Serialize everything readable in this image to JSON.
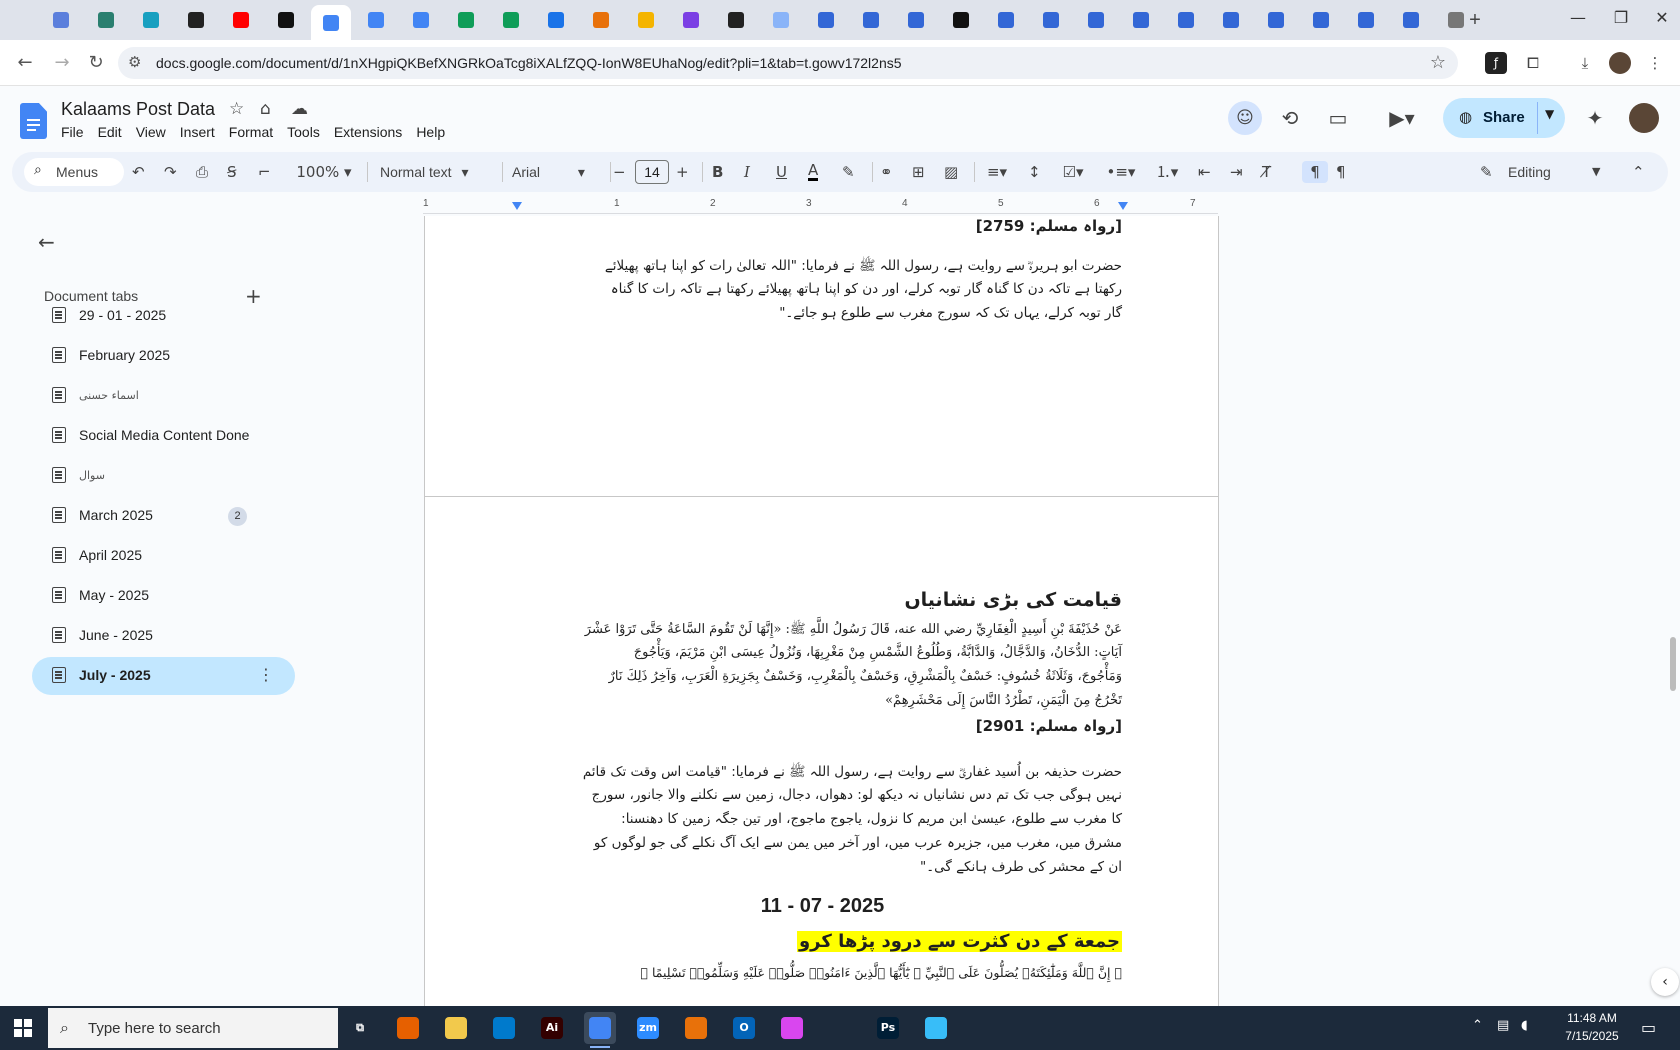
{
  "browser": {
    "tabs": [
      {
        "icon": "gemini-icon",
        "color": "#5b7fdc"
      },
      {
        "icon": "app-icon",
        "color": "#2a7f6f"
      },
      {
        "icon": "app-icon",
        "color": "#18a0c0"
      },
      {
        "icon": "chatgpt-icon",
        "color": "#222222"
      },
      {
        "icon": "youtube-icon",
        "color": "#ff0000"
      },
      {
        "icon": "app-icon",
        "color": "#111111"
      },
      {
        "icon": "docs-icon",
        "color": "#4285f4",
        "active": true
      },
      {
        "icon": "docs-icon",
        "color": "#4285f4"
      },
      {
        "icon": "docs-icon",
        "color": "#4285f4"
      },
      {
        "icon": "sheets-icon",
        "color": "#0f9d58"
      },
      {
        "icon": "sheets-icon",
        "color": "#0f9d58"
      },
      {
        "icon": "app-icon",
        "color": "#1a73e8"
      },
      {
        "icon": "app-icon",
        "color": "#e8710a"
      },
      {
        "icon": "app-icon",
        "color": "#f4b400"
      },
      {
        "icon": "app-icon",
        "color": "#7b3fe4"
      },
      {
        "icon": "app-icon",
        "color": "#222222"
      },
      {
        "icon": "app-icon",
        "color": "#8ab4f8"
      },
      {
        "icon": "forms-icon",
        "color": "#3367d6"
      },
      {
        "icon": "forms-icon",
        "color": "#3367d6"
      },
      {
        "icon": "forms-icon",
        "color": "#3367d6"
      },
      {
        "icon": "app-icon",
        "color": "#111111"
      },
      {
        "icon": "forms-icon",
        "color": "#3367d6"
      },
      {
        "icon": "forms-icon",
        "color": "#3367d6"
      },
      {
        "icon": "forms-icon",
        "color": "#3367d6"
      },
      {
        "icon": "forms-icon",
        "color": "#3367d6"
      },
      {
        "icon": "forms-icon",
        "color": "#3367d6"
      },
      {
        "icon": "forms-icon",
        "color": "#3367d6"
      },
      {
        "icon": "forms-icon",
        "color": "#3367d6"
      },
      {
        "icon": "forms-icon",
        "color": "#3367d6"
      },
      {
        "icon": "forms-icon",
        "color": "#3367d6"
      },
      {
        "icon": "forms-icon",
        "color": "#3367d6"
      },
      {
        "icon": "chrome-icon",
        "color": "#777777"
      }
    ],
    "new_tab": "+",
    "url": "docs.google.com/document/d/1nXHgpiQKBefXNGRkOaTcg8iXALfZQQ-IonW8EUhaNog/edit?pli=1&tab=t.gowv172l2ns5"
  },
  "doc": {
    "title": "Kalaams Post Data",
    "menu": [
      "File",
      "Edit",
      "View",
      "Insert",
      "Format",
      "Tools",
      "Extensions",
      "Help"
    ],
    "share_label": "Share"
  },
  "toolbar": {
    "menus_label": "Menus",
    "zoom": "100%",
    "style": "Normal text",
    "font": "Arial",
    "font_size": "14",
    "mode": "Editing"
  },
  "ruler": [
    "1",
    "1",
    "2",
    "3",
    "4",
    "5",
    "6",
    "7"
  ],
  "sidebar": {
    "heading": "Document tabs",
    "tabs": [
      {
        "label": "29 - 01 - 2025"
      },
      {
        "label": "February 2025"
      },
      {
        "label": "اسماء حسنی"
      },
      {
        "label": "Social Media Content Done"
      },
      {
        "label": "سوال"
      },
      {
        "label": "March 2025",
        "badge": "2"
      },
      {
        "label": "April 2025"
      },
      {
        "label": "May - 2025"
      },
      {
        "label": "June - 2025"
      },
      {
        "label": "July - 2025",
        "selected": true
      }
    ]
  },
  "content": {
    "page1": {
      "ref_top": "[رواہ مسلم: 2759]",
      "para": [
        "حضرت ابو ہریرہؓ سے روایت ہے، رسول اللہ ﷺ نے فرمایا: \"اللہ تعالیٰ رات کو اپنا ہاتھ پھیلائے",
        "رکھتا ہے تاکہ دن کا گناہ گار توبہ کرلے، اور دن کو اپنا ہاتھ پھیلائے رکھتا ہے تاکہ رات کا گناہ",
        "گار توبہ کرلے، یہاں تک کہ سورج مغرب سے طلوع ہو جائے۔\""
      ]
    },
    "page2": {
      "heading": "قیامت کی بڑی نشانیاں",
      "arabic": [
        "عَنْ حُذَيْفَةَ بْنِ أَسِيدٍ الْغِفَارِيِّ رضي الله عنه، قَالَ رَسُولُ اللَّهِ ﷺ: «إِنَّهَا لَنْ تَقُومَ السَّاعَةُ حَتَّى تَرَوْا عَشْرَ",
        "آيَاتٍ: الدُّخَانُ، وَالدَّجَّالُ، وَالدَّابَّةُ، وَطُلُوعُ الشَّمْسِ مِنْ مَغْرِبِهَا، وَنُزُولُ عِيسَى ابْنِ مَرْيَمَ، وَيَأْجُوجَ",
        "وَمَأْجُوجَ، وَثَلَاثَةُ خُسُوفٍ: خَسْفٌ بِالْمَشْرِقِ، وَخَسْفٌ بِالْمَغْرِبِ، وَخَسْفٌ بِجَزِيرَةِ الْعَرَبِ، وَآخِرُ ذَلِكَ نَارٌ",
        "تَخْرُجُ مِنَ الْيَمَنِ، تَطْرُدُ النَّاسَ إِلَى مَحْشَرِهِمْ»"
      ],
      "ref": "[رواہ مسلم: 2901]",
      "urdu": [
        "حضرت حذیفہ بن اُسید غفاریؓ سے روایت ہے، رسول اللہ ﷺ نے فرمایا: \"قیامت اس وقت تک قائم",
        "نہیں ہوگی جب تک تم دس نشانیاں نہ دیکھ لو: دھواں، دجال، زمین سے نکلنے والا جانور، سورج",
        "کا مغرب سے طلوع، عیسیٰ ابن مریم کا نزول، یاجوج ماجوج، اور تین جگہ زمین کا دھنسنا:",
        "مشرق میں، مغرب میں، جزیرہ عرب میں، اور آخر میں یمن سے ایک آگ نکلے گی جو لوگوں کو",
        "ان کے محشر کی طرف ہانکے گی۔\""
      ],
      "date": "11 - 07 - 2025",
      "highlight_heading": "جمعة کے دن کثرت سے درود پڑھا کرو",
      "verse": "﴿ إِنَّ ٱللَّهَ وَمَلَٰٓئِكَتَهُۥ يُصَلُّونَ عَلَى ٱلنَّبِيِّ ۚ يَٰٓأَيُّهَا ٱلَّذِينَ ءَامَنُوا۟ صَلُّوا۟ عَلَيْهِ وَسَلِّمُوا۟ تَسْلِيمًا ﴾"
    }
  },
  "taskbar": {
    "search_placeholder": "Type here to search",
    "time": "11:48 AM",
    "date": "7/15/2025",
    "apps": [
      {
        "icon": "task-view-icon",
        "label": "⧉",
        "color": "transparent"
      },
      {
        "icon": "firefox-icon",
        "label": "",
        "color": "#e66000"
      },
      {
        "icon": "file-explorer-icon",
        "label": "",
        "color": "#f2c94c"
      },
      {
        "icon": "vscode-icon",
        "label": "",
        "color": "#007acc"
      },
      {
        "icon": "illustrator-icon",
        "label": "Ai",
        "color": "#330000"
      },
      {
        "icon": "chrome-icon",
        "label": "",
        "color": "#4285f4",
        "active": true
      },
      {
        "icon": "zoom-icon",
        "label": "zm",
        "color": "#2d8cff"
      },
      {
        "icon": "app-icon",
        "label": "",
        "color": "#e8710a"
      },
      {
        "icon": "outlook-icon",
        "label": "O",
        "color": "#0364b8"
      },
      {
        "icon": "app-icon",
        "label": "",
        "color": "#d946ef"
      },
      {
        "icon": "pen-icon",
        "label": "",
        "color": "transparent"
      },
      {
        "icon": "photoshop-icon",
        "label": "Ps",
        "color": "#001e36"
      },
      {
        "icon": "app-icon",
        "label": "",
        "color": "#38bdf8"
      }
    ]
  }
}
